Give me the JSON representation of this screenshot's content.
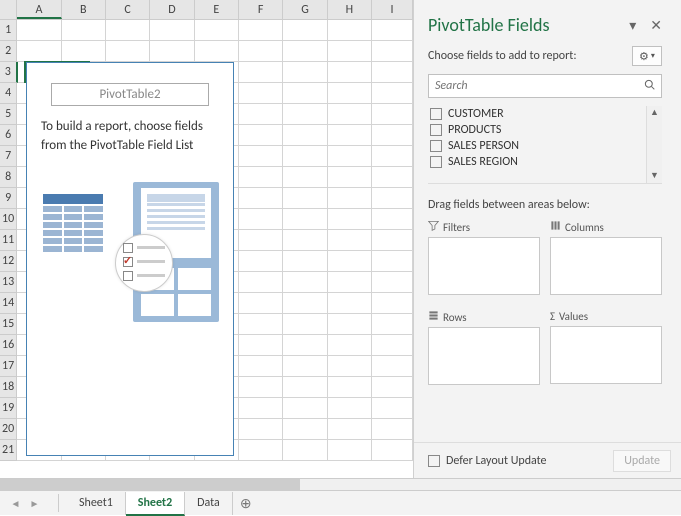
{
  "columns": [
    "A",
    "B",
    "C",
    "D",
    "E",
    "F",
    "G",
    "H",
    "I"
  ],
  "row_count": 21,
  "active_cell": {
    "col": 0,
    "row": 3
  },
  "pivot_placeholder": {
    "title": "PivotTable2",
    "message1": "To build a report, choose fields",
    "message2": "from the PivotTable Field List"
  },
  "taskpane": {
    "title": "PivotTable Fields",
    "subtitle": "Choose fields to add to report:",
    "search_placeholder": "Search",
    "fields": [
      "CUSTOMER",
      "PRODUCTS",
      "SALES PERSON",
      "SALES REGION"
    ],
    "drag_label": "Drag fields between areas below:",
    "areas": {
      "filters": "Filters",
      "columns": "Columns",
      "rows": "Rows",
      "values": "Values"
    },
    "defer_label": "Defer Layout Update",
    "update_label": "Update"
  },
  "sheets": {
    "items": [
      "Sheet1",
      "Sheet2",
      "Data"
    ],
    "active": 1
  }
}
